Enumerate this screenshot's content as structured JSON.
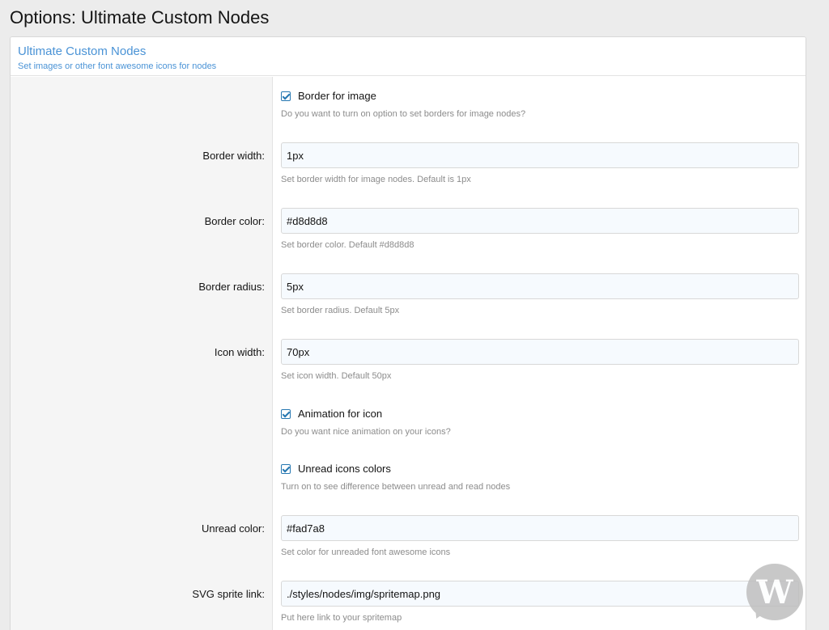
{
  "page": {
    "title": "Options: Ultimate Custom Nodes"
  },
  "block": {
    "title": "Ultimate Custom Nodes",
    "description": "Set images or other font awesome icons for nodes"
  },
  "options": {
    "border_for_image": {
      "label": "Border for image",
      "checked": true,
      "hint": "Do you want to turn on option to set borders for image nodes?"
    },
    "border_width": {
      "label": "Border width:",
      "value": "1px",
      "hint": "Set border width for image nodes. Default is 1px"
    },
    "border_color": {
      "label": "Border color:",
      "value": "#d8d8d8",
      "hint": "Set border color. Default #d8d8d8"
    },
    "border_radius": {
      "label": "Border radius:",
      "value": "5px",
      "hint": "Set border radius. Default 5px"
    },
    "icon_width": {
      "label": "Icon width:",
      "value": "70px",
      "hint": "Set icon width. Default 50px"
    },
    "animation_for_icon": {
      "label": "Animation for icon",
      "checked": true,
      "hint": "Do you want nice animation on your icons?"
    },
    "unread_icons_colors": {
      "label": "Unread icons colors",
      "checked": true,
      "hint": "Turn on to see difference between unread and read nodes"
    },
    "unread_color": {
      "label": "Unread color:",
      "value": "#fad7a8",
      "hint": "Set color for unreaded font awesome icons"
    },
    "svg_sprite_link": {
      "label": "SVG sprite link:",
      "value": "./styles/nodes/img/spritemap.png",
      "hint": "Put here link to your spritemap"
    }
  },
  "watermark": {
    "letter": "W"
  },
  "colors": {
    "accent": "#4a93d6",
    "checkbox": "#2577b1",
    "input_bg": "#f6fafe",
    "label_col_bg": "#f5f5f5"
  }
}
